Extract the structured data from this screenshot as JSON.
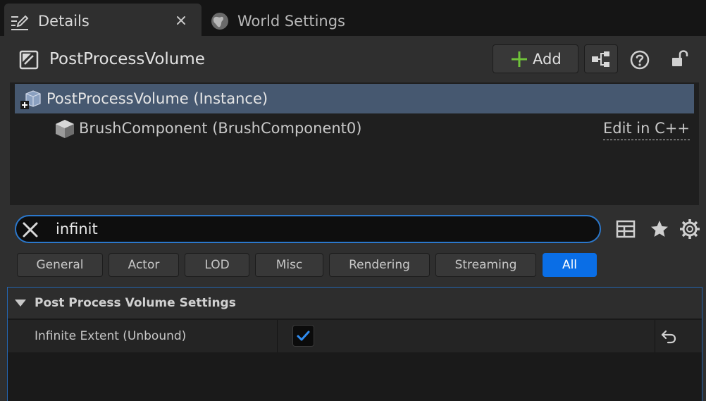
{
  "tabs": [
    {
      "label": "Details",
      "icon": "pencil-icon",
      "active": true,
      "closable": true
    },
    {
      "label": "World Settings",
      "icon": "globe-icon",
      "active": false
    }
  ],
  "header": {
    "actor_name": "PostProcessVolume",
    "actor_icon": "post-process-volume-icon",
    "add_label": "Add"
  },
  "components": [
    {
      "label": "PostProcessVolume (Instance)",
      "icon": "instance-icon",
      "selected": true
    },
    {
      "label": "BrushComponent (BrushComponent0)",
      "icon": "cube-icon",
      "action": "Edit in C++"
    }
  ],
  "search": {
    "value": "infinit"
  },
  "filters": [
    {
      "label": "General",
      "active": false
    },
    {
      "label": "Actor",
      "active": false
    },
    {
      "label": "LOD",
      "active": false
    },
    {
      "label": "Misc",
      "active": false
    },
    {
      "label": "Rendering",
      "active": false
    },
    {
      "label": "Streaming",
      "active": false
    },
    {
      "label": "All",
      "active": true
    }
  ],
  "section": {
    "title": "Post Process Volume Settings",
    "properties": [
      {
        "name": "Infinite Extent (Unbound)",
        "checked": true
      }
    ]
  },
  "colors": {
    "accent": "#0a6ee6",
    "selection": "#465870",
    "check": "#2f8cf0",
    "add_plus": "#6fc23a"
  }
}
